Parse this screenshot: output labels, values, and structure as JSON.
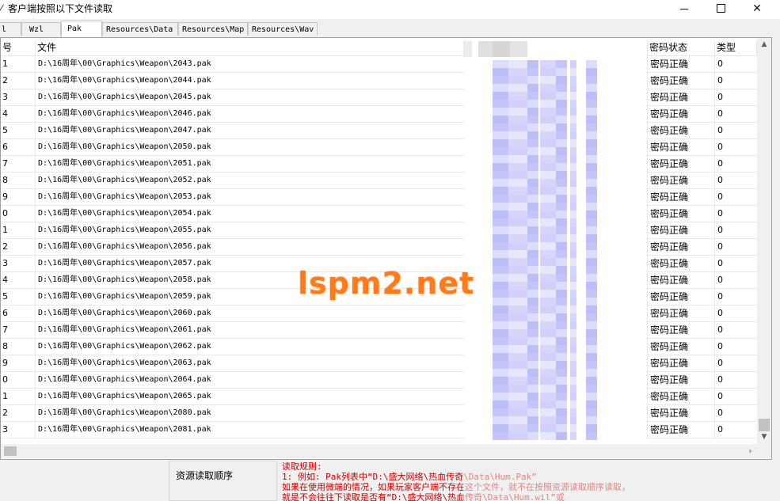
{
  "window": {
    "title": "客户端按照以下文件读取",
    "icon": "app-icon",
    "minimize_icon": "minimize-icon",
    "maximize_icon": "maximize-icon",
    "close_icon": "close-icon",
    "close_glyph": "✕"
  },
  "tabs": [
    {
      "label": "l",
      "active": false
    },
    {
      "label": "Wzl",
      "active": false
    },
    {
      "label": "Pak",
      "active": true
    },
    {
      "label": "Resources\\Data",
      "active": false
    },
    {
      "label": "Resources\\Map",
      "active": false
    },
    {
      "label": "Resources\\Wav",
      "active": false
    }
  ],
  "table": {
    "headers": {
      "no": "号",
      "file": "文件",
      "status": "密码状态",
      "type": "类型"
    },
    "rows": [
      {
        "no": "1",
        "file": "D:\\16周年\\00\\Graphics\\Weapon\\2043.pak",
        "status": "密码正确",
        "type": "0"
      },
      {
        "no": "2",
        "file": "D:\\16周年\\00\\Graphics\\Weapon\\2044.pak",
        "status": "密码正确",
        "type": "0"
      },
      {
        "no": "3",
        "file": "D:\\16周年\\00\\Graphics\\Weapon\\2045.pak",
        "status": "密码正确",
        "type": "0"
      },
      {
        "no": "4",
        "file": "D:\\16周年\\00\\Graphics\\Weapon\\2046.pak",
        "status": "密码正确",
        "type": "0"
      },
      {
        "no": "5",
        "file": "D:\\16周年\\00\\Graphics\\Weapon\\2047.pak",
        "status": "密码正确",
        "type": "0"
      },
      {
        "no": "6",
        "file": "D:\\16周年\\00\\Graphics\\Weapon\\2050.pak",
        "status": "密码正确",
        "type": "0"
      },
      {
        "no": "7",
        "file": "D:\\16周年\\00\\Graphics\\Weapon\\2051.pak",
        "status": "密码正确",
        "type": "0"
      },
      {
        "no": "8",
        "file": "D:\\16周年\\00\\Graphics\\Weapon\\2052.pak",
        "status": "密码正确",
        "type": "0"
      },
      {
        "no": "9",
        "file": "D:\\16周年\\00\\Graphics\\Weapon\\2053.pak",
        "status": "密码正确",
        "type": "0"
      },
      {
        "no": "0",
        "file": "D:\\16周年\\00\\Graphics\\Weapon\\2054.pak",
        "status": "密码正确",
        "type": "0"
      },
      {
        "no": "1",
        "file": "D:\\16周年\\00\\Graphics\\Weapon\\2055.pak",
        "status": "密码正确",
        "type": "0"
      },
      {
        "no": "2",
        "file": "D:\\16周年\\00\\Graphics\\Weapon\\2056.pak",
        "status": "密码正确",
        "type": "0"
      },
      {
        "no": "3",
        "file": "D:\\16周年\\00\\Graphics\\Weapon\\2057.pak",
        "status": "密码正确",
        "type": "0"
      },
      {
        "no": "4",
        "file": "D:\\16周年\\00\\Graphics\\Weapon\\2058.pak",
        "status": "密码正确",
        "type": "0"
      },
      {
        "no": "5",
        "file": "D:\\16周年\\00\\Graphics\\Weapon\\2059.pak",
        "status": "密码正确",
        "type": "0"
      },
      {
        "no": "6",
        "file": "D:\\16周年\\00\\Graphics\\Weapon\\2060.pak",
        "status": "密码正确",
        "type": "0"
      },
      {
        "no": "7",
        "file": "D:\\16周年\\00\\Graphics\\Weapon\\2061.pak",
        "status": "密码正确",
        "type": "0"
      },
      {
        "no": "8",
        "file": "D:\\16周年\\00\\Graphics\\Weapon\\2062.pak",
        "status": "密码正确",
        "type": "0"
      },
      {
        "no": "9",
        "file": "D:\\16周年\\00\\Graphics\\Weapon\\2063.pak",
        "status": "密码正确",
        "type": "0"
      },
      {
        "no": "0",
        "file": "D:\\16周年\\00\\Graphics\\Weapon\\2064.pak",
        "status": "密码正确",
        "type": "0"
      },
      {
        "no": "1",
        "file": "D:\\16周年\\00\\Graphics\\Weapon\\2065.pak",
        "status": "密码正确",
        "type": "0"
      },
      {
        "no": "2",
        "file": "D:\\16周年\\00\\Graphics\\Weapon\\2080.pak",
        "status": "密码正确",
        "type": "0"
      },
      {
        "no": "3",
        "file": "D:\\16周年\\00\\Graphics\\Weapon\\2081.pak",
        "status": "密码正确",
        "type": "0"
      }
    ]
  },
  "scrollbars": {
    "up_glyph": "▲",
    "down_glyph": "▼",
    "right_glyph": "›"
  },
  "watermark": "lspm2.net",
  "bottom": {
    "order_label": "资源读取顺序",
    "rules": [
      "读取规则:",
      "1: 例如: Pak列表中“D:\\盛大网络\\热血传奇\\Data\\Hum.Pak”",
      "   如果在使用微端的情况，如果玩家客户端不存在这个文件，就不在按照资源读取顺序读取，",
      "   就是不会往往下读取是否有“D:\\盛大网络\\热血传奇\\Data\\Hum.wil”或"
    ]
  },
  "colors": {
    "rules_text": "#cc0000",
    "watermark": "#ff7a1a",
    "blur_tint": "#c8c8ff"
  }
}
